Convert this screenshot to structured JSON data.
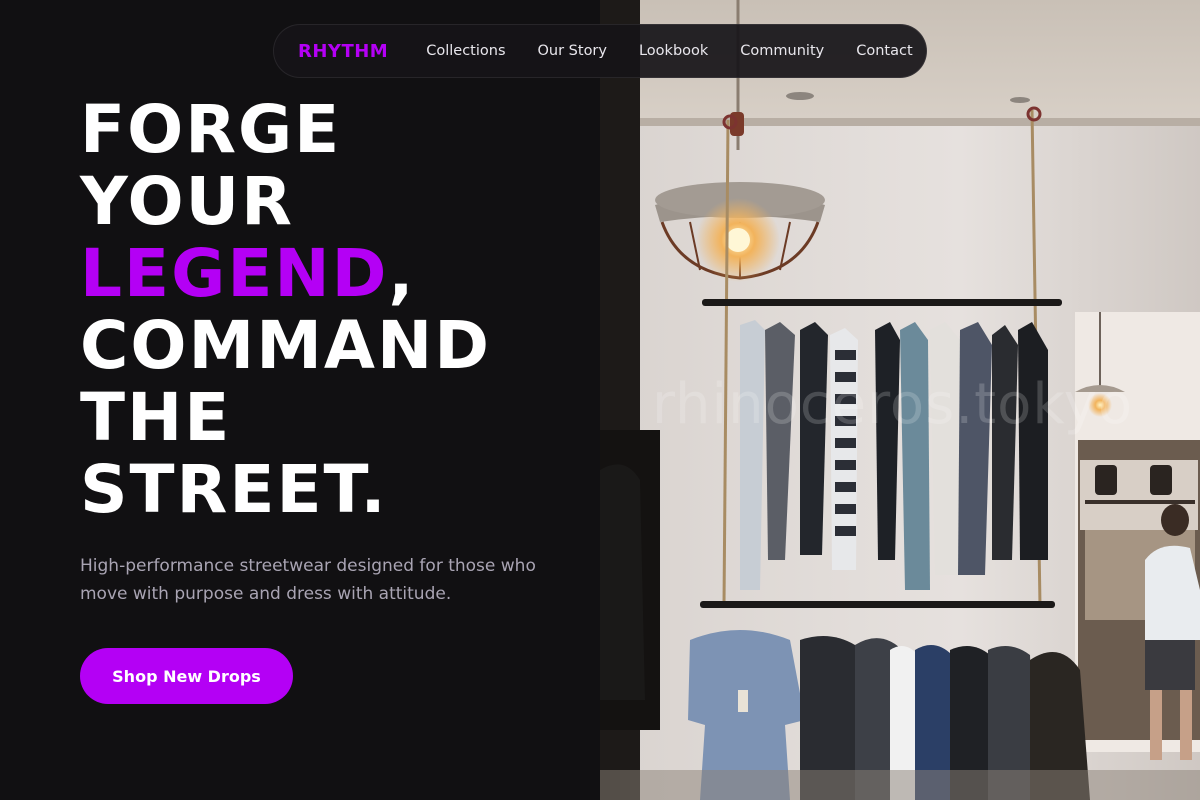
{
  "brand": {
    "name": "RHYTHM",
    "accent": "#b400f5"
  },
  "nav": {
    "links": [
      "Collections",
      "Our Story",
      "Lookbook",
      "Community",
      "Contact"
    ]
  },
  "hero": {
    "line1": "FORGE",
    "line2": "YOUR",
    "line3_accent": "LEGEND",
    "line3_rest": ",",
    "line4": "COMMAND",
    "line5": "THE",
    "line6": "STREET.",
    "subtext": "High-performance streetwear designed for those who move with purpose and dress with attitude.",
    "cta_label": "Shop New Drops"
  },
  "photo": {
    "watermark": "rhinoceros.tokyo"
  },
  "colors": {
    "background": "#111012",
    "text": "#ffffff",
    "muted": "#a9a4b3"
  }
}
